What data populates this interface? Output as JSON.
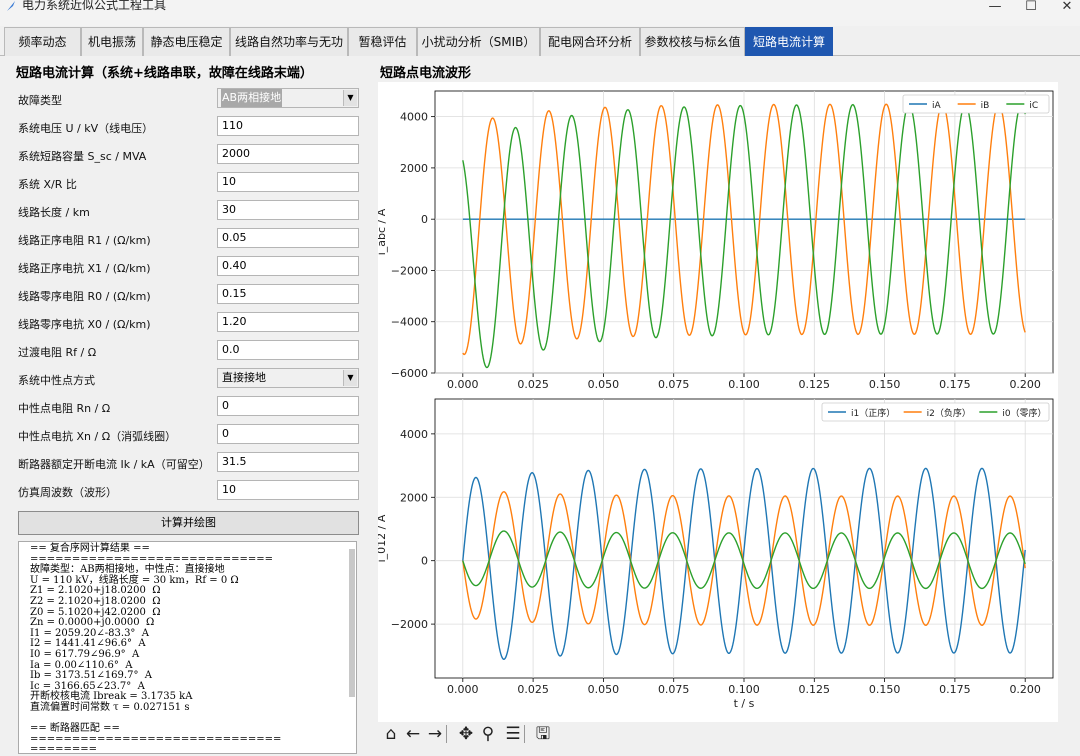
{
  "window": {
    "title": "电力系统近似公式工程工具"
  },
  "tabs": [
    "频率动态",
    "机电振荡",
    "静态电压稳定",
    "线路自然功率与无功",
    "暂稳评估",
    "小扰动分析（SMIB）",
    "配电网合环分析",
    "参数校核与标幺值",
    "短路电流计算"
  ],
  "active_tab": 8,
  "left_panel": {
    "title": "短路电流计算（系统+线路串联，故障在线路末端）",
    "fields": [
      {
        "label": "故障类型",
        "value": "AB两相接地",
        "kind": "select"
      },
      {
        "label": "系统电压 U / kV（线电压）",
        "value": "110",
        "kind": "input"
      },
      {
        "label": "系统短路容量 S_sc / MVA",
        "value": "2000",
        "kind": "input"
      },
      {
        "label": "系统 X/R 比",
        "value": "10",
        "kind": "input"
      },
      {
        "label": "线路长度 / km",
        "value": "30",
        "kind": "input"
      },
      {
        "label": "线路正序电阻 R1 / (Ω/km)",
        "value": "0.05",
        "kind": "input"
      },
      {
        "label": "线路正序电抗 X1 / (Ω/km)",
        "value": "0.40",
        "kind": "input"
      },
      {
        "label": "线路零序电阻 R0 / (Ω/km)",
        "value": "0.15",
        "kind": "input"
      },
      {
        "label": "线路零序电抗 X0 / (Ω/km)",
        "value": "1.20",
        "kind": "input"
      },
      {
        "label": "过渡电阻 Rf / Ω",
        "value": "0.0",
        "kind": "input"
      },
      {
        "label": "系统中性点方式",
        "value": "直接接地",
        "kind": "select"
      },
      {
        "label": "中性点电阻 Rn / Ω",
        "value": "0",
        "kind": "input"
      },
      {
        "label": "中性点电抗 Xn / Ω（消弧线圈）",
        "value": "0",
        "kind": "input"
      },
      {
        "label": "断路器额定开断电流 Ik / kA（可留空）",
        "value": "31.5",
        "kind": "input"
      },
      {
        "label": "仿真周波数（波形）",
        "value": "10",
        "kind": "input"
      }
    ],
    "calc_button": "计算并绘图",
    "result_lines": [
      "== 复合序网计算结果 ==",
      "=============================",
      "故障类型：AB两相接地，中性点：直接接地",
      "U = 110 kV，线路长度 = 30 km，Rf = 0 Ω",
      "Z1 = 2.1020+j18.0200  Ω",
      "Z2 = 2.1020+j18.0200  Ω",
      "Z0 = 5.1020+j42.0200  Ω",
      "Zn = 0.0000+j0.0000  Ω",
      "I1 = 2059.20∠-83.3°  A",
      "I2 = 1441.41∠96.6°  A",
      "I0 = 617.79∠96.9°  A",
      "Ia = 0.00∠110.6°  A",
      "Ib = 3173.51∠169.7°  A",
      "Ic = 3166.65∠23.7°  A",
      "开断校核电流 Ibreak = 3.1735 kA",
      "直流偏置时间常数 τ = 0.027151 s",
      "",
      "== 断路器匹配 ==",
      "==============================",
      "========"
    ]
  },
  "right_panel": {
    "title": "短路点电流波形"
  },
  "chart_data": [
    {
      "type": "line",
      "xlabel": "",
      "ylabel": "i_abc / A",
      "xlim": [
        0,
        0.2
      ],
      "ylim": [
        -6000,
        5000
      ],
      "xticks": [
        "0.000",
        "0.025",
        "0.050",
        "0.075",
        "0.100",
        "0.125",
        "0.150",
        "0.175",
        "0.200"
      ],
      "yticks": [
        "4000",
        "2000",
        "0",
        "−2000",
        "−4000",
        "−6000"
      ],
      "grid": true,
      "legend_position": "top-right",
      "sampling": {
        "x_start": 0,
        "x_end": 0.2,
        "freq_hz": 50,
        "tau_s": 0.027151
      },
      "series": [
        {
          "name": "iA",
          "color": "#1f77b4",
          "amplitude": 0,
          "phase_deg": 110.6,
          "dc_offset": 0
        },
        {
          "name": "iB",
          "color": "#ff7f0e",
          "amplitude": 4488,
          "phase_deg": 169.7,
          "dc_offset": -803
        },
        {
          "name": "iC",
          "color": "#2ca02c",
          "amplitude": 4478,
          "phase_deg": 23.7,
          "dc_offset": -1800
        }
      ],
      "series_note": "instantaneous value = amplitude·cos(2π·50·t + phase) + dc_offset·exp(−t/tau)"
    },
    {
      "type": "line",
      "xlabel": "t / s",
      "ylabel": "i_012 / A",
      "xlim": [
        0,
        0.2
      ],
      "ylim": [
        -3700,
        5100
      ],
      "xticks": [
        "0.000",
        "0.025",
        "0.050",
        "0.075",
        "0.100",
        "0.125",
        "0.150",
        "0.175",
        "0.200"
      ],
      "yticks": [
        "4000",
        "2000",
        "0",
        "−2000"
      ],
      "grid": true,
      "legend_position": "top-right",
      "sampling": {
        "x_start": 0,
        "x_end": 0.2,
        "freq_hz": 50,
        "tau_s": 0.027151
      },
      "series": [
        {
          "name": "i1（正序）",
          "color": "#1f77b4",
          "amplitude": 2912,
          "phase_deg": -83.3,
          "dc_offset": -340
        },
        {
          "name": "i2（负序）",
          "color": "#ff7f0e",
          "amplitude": 2038,
          "phase_deg": 96.6,
          "dc_offset": 234
        },
        {
          "name": "i0（零序）",
          "color": "#2ca02c",
          "amplitude": 874,
          "phase_deg": 96.9,
          "dc_offset": 105
        }
      ]
    }
  ],
  "toolbar": {
    "buttons": [
      {
        "icon": "home-icon",
        "glyph": "⌂"
      },
      {
        "icon": "back-icon",
        "glyph": "←"
      },
      {
        "icon": "forward-icon",
        "glyph": "→"
      },
      {
        "icon": "pan-icon",
        "glyph": "✥"
      },
      {
        "icon": "zoom-icon",
        "glyph": "⚲"
      },
      {
        "icon": "configure-icon",
        "glyph": "☰"
      },
      {
        "icon": "save-icon",
        "glyph": "🖫"
      }
    ]
  }
}
